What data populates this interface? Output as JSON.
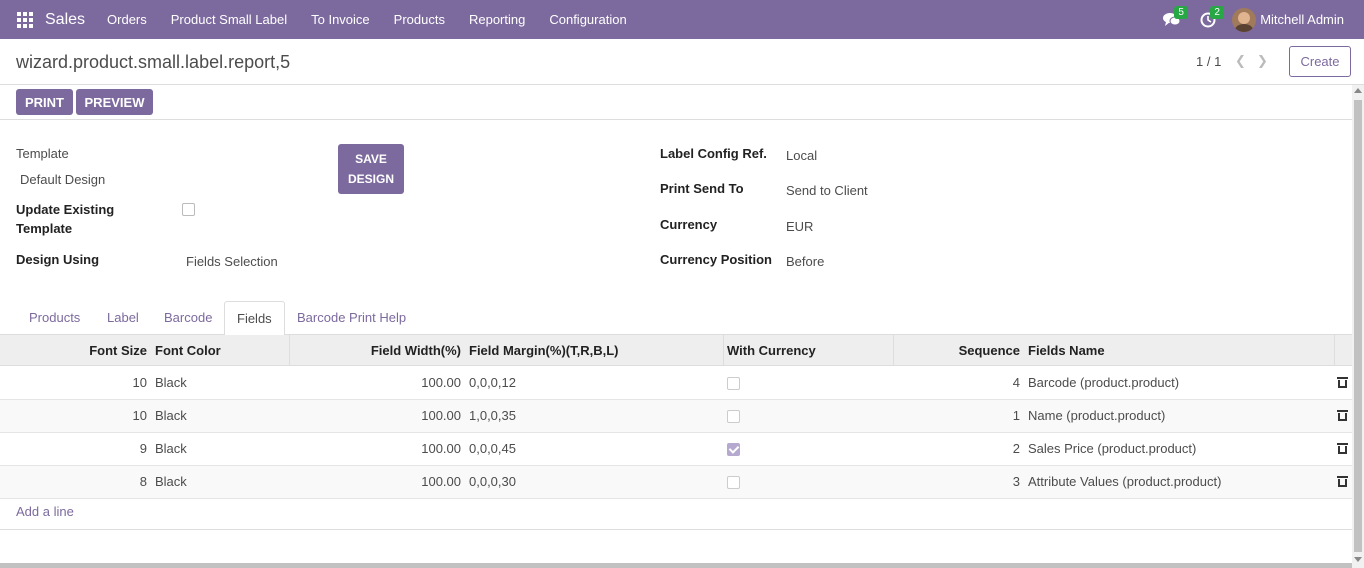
{
  "navbar": {
    "app_name": "Sales",
    "menu": [
      "Orders",
      "Product Small Label",
      "To Invoice",
      "Products",
      "Reporting",
      "Configuration"
    ],
    "messages_count": "5",
    "activities_count": "2",
    "user_name": "Mitchell Admin",
    "icons": {
      "apps": "apps-grid-icon",
      "messages": "chat-bubbles-icon",
      "activities": "clock-icon"
    }
  },
  "control_panel": {
    "breadcrumb": "wizard.product.small.label.report,5",
    "pager": "1 / 1",
    "create_label": "Create"
  },
  "statusbar": {
    "print_label": "PRINT",
    "preview_label": "PREVIEW"
  },
  "form": {
    "template_label": "Template",
    "template_value": "Default Design",
    "save_design_line1": "SAVE",
    "save_design_line2": "DESIGN",
    "update_existing_line1": "Update Existing",
    "update_existing_line2": "Template",
    "update_existing_checked": false,
    "design_using_label": "Design Using",
    "design_using_value": "Fields Selection",
    "label_config_label": "Label Config Ref.",
    "label_config_value": "Local",
    "print_send_label": "Print Send To",
    "print_send_value": "Send to Client",
    "currency_label": "Currency",
    "currency_value": "EUR",
    "currency_position_label": "Currency Position",
    "currency_position_value": "Before"
  },
  "tabs": [
    "Products",
    "Label",
    "Barcode",
    "Fields",
    "Barcode Print Help"
  ],
  "active_tab": "Fields",
  "table": {
    "headers": {
      "font_size": "Font Size",
      "font_color": "Font Color",
      "field_width": "Field Width(%)",
      "field_margin": "Field Margin(%)(T,R,B,L)",
      "with_currency": "With Currency",
      "sequence": "Sequence",
      "fields_name": "Fields Name"
    },
    "rows": [
      {
        "font_size": "10",
        "font_color": "Black",
        "field_width": "100.00",
        "field_margin": "0,0,0,12",
        "with_currency": false,
        "sequence": "4",
        "fields_name": "Barcode (product.product)"
      },
      {
        "font_size": "10",
        "font_color": "Black",
        "field_width": "100.00",
        "field_margin": "1,0,0,35",
        "with_currency": false,
        "sequence": "1",
        "fields_name": "Name (product.product)"
      },
      {
        "font_size": "9",
        "font_color": "Black",
        "field_width": "100.00",
        "field_margin": "0,0,0,45",
        "with_currency": true,
        "sequence": "2",
        "fields_name": "Sales Price (product.product)"
      },
      {
        "font_size": "8",
        "font_color": "Black",
        "field_width": "100.00",
        "field_margin": "0,0,0,30",
        "with_currency": false,
        "sequence": "3",
        "fields_name": "Attribute Values (product.product)"
      }
    ],
    "add_line_label": "Add a line"
  },
  "colors": {
    "brand": "#7c6a9e",
    "badge": "#28a745"
  }
}
